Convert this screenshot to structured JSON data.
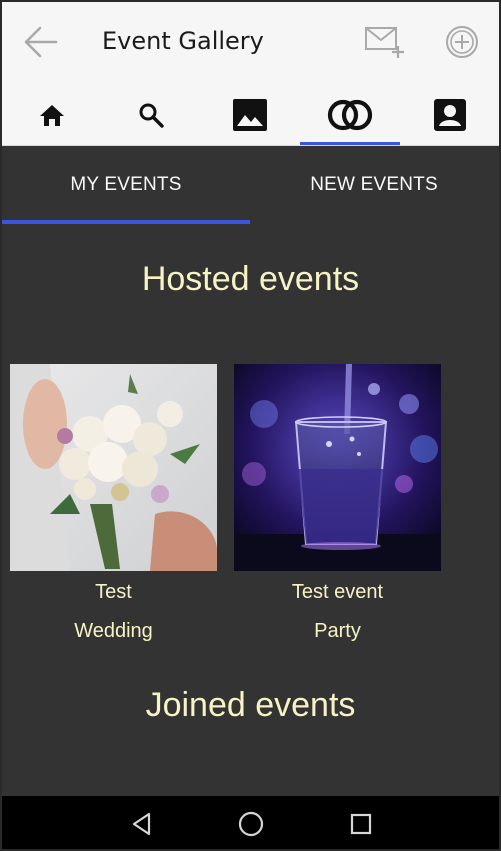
{
  "header": {
    "title": "Event Gallery",
    "icons": {
      "back": "arrow-left-icon",
      "invite": "mail-plus-icon",
      "add": "plus-circle-icon"
    }
  },
  "nav": {
    "items": [
      {
        "icon": "home-icon",
        "active": false
      },
      {
        "icon": "search-icon",
        "active": false
      },
      {
        "icon": "image-icon",
        "active": false
      },
      {
        "icon": "rings-icon",
        "active": true
      },
      {
        "icon": "profile-icon",
        "active": false
      }
    ]
  },
  "tabs": [
    {
      "label": "MY EVENTS",
      "active": true
    },
    {
      "label": "NEW EVENTS",
      "active": false
    }
  ],
  "sections": {
    "hosted_title": "Hosted events",
    "joined_title": "Joined events"
  },
  "events": [
    {
      "title": "Test",
      "type": "Wedding",
      "image": "bouquet-photo"
    },
    {
      "title": "Test event",
      "type": "Party",
      "image": "glass-photo"
    }
  ],
  "system_nav": {
    "back": "triangle-back-icon",
    "home": "circle-home-icon",
    "recents": "square-recents-icon"
  },
  "colors": {
    "accent": "#3b55e0",
    "background": "#333333",
    "text_highlight": "#f8f3c5",
    "header_bg": "#f6f6f6"
  }
}
